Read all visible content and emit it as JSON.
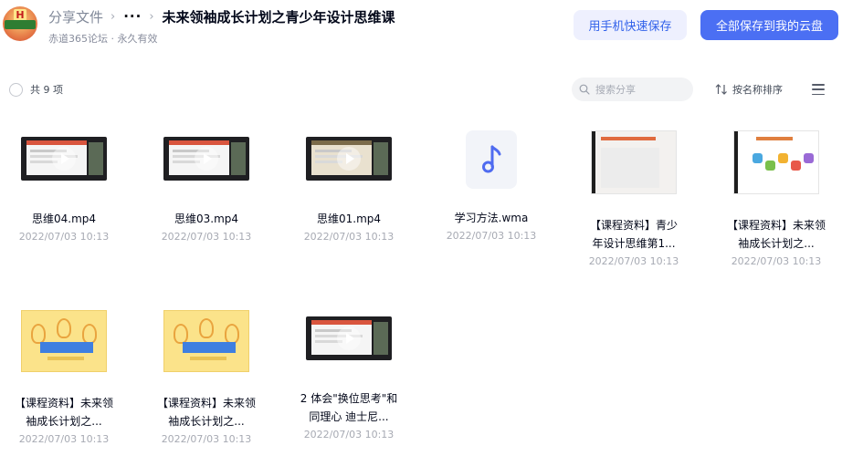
{
  "header": {
    "breadcrumb_root": "分享文件",
    "breadcrumb_sep": "›",
    "breadcrumb_more": "···",
    "title": "未来领袖成长计划之青少年设计思维课",
    "subtitle": "赤道365论坛 · 永久有效",
    "btn_mobile": "用手机快速保存",
    "btn_save_all": "全部保存到我的云盘"
  },
  "toolbar": {
    "count_label": "共 9 项",
    "search_placeholder": "搜索分享",
    "sort_label": "按名称排序"
  },
  "files": [
    {
      "name": "思维04.mp4",
      "date": "2022/07/03 10:13",
      "kind": "video"
    },
    {
      "name": "思维03.mp4",
      "date": "2022/07/03 10:13",
      "kind": "video"
    },
    {
      "name": "思维01.mp4",
      "date": "2022/07/03 10:13",
      "kind": "video"
    },
    {
      "name": "学习方法.wma",
      "date": "2022/07/03 10:13",
      "kind": "audio"
    },
    {
      "name": "【课程资料】青少年设计思维第1...",
      "date": "2022/07/03 10:13",
      "kind": "document"
    },
    {
      "name": "【课程资料】未来领袖成长计划之...",
      "date": "2022/07/03 10:13",
      "kind": "document"
    },
    {
      "name": "【课程资料】未来领袖成长计划之...",
      "date": "2022/07/03 10:13",
      "kind": "image"
    },
    {
      "name": "【课程资料】未来领袖成长计划之...",
      "date": "2022/07/03 10:13",
      "kind": "image"
    },
    {
      "name": "2 体会\"换位思考\"和同理心 迪士尼...",
      "date": "2022/07/03 10:13",
      "kind": "video"
    }
  ],
  "colors": {
    "primary": "#4b6ff3",
    "secondary_bg": "#eef0fe",
    "audio_note": "#4f6bf0"
  }
}
